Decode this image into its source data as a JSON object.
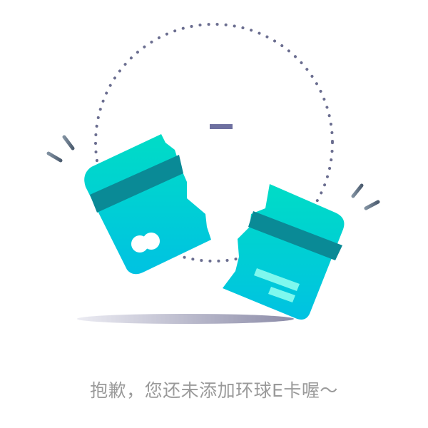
{
  "empty_state": {
    "message": "抱歉，您还未添加环球E卡喔～",
    "illustration": "broken-card-icon"
  },
  "colors": {
    "card_light": "#00d8c8",
    "card_dark": "#00c4e0",
    "stripe": "#0a8a96",
    "dots": "#6b6e90",
    "message": "#9a9a9a"
  }
}
